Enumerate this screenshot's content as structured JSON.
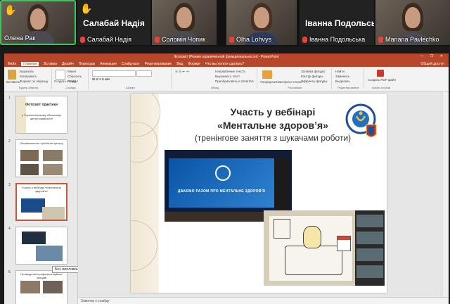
{
  "participants": [
    {
      "name": "Олена Рак",
      "hand_raised": true,
      "muted": false,
      "active_speaker": true,
      "video": true
    },
    {
      "name": "Салабай Надія",
      "big_label": "Салабай Надія",
      "hand_raised": true,
      "muted": true,
      "video": false
    },
    {
      "name": "Соломія Чопик",
      "hand_raised": false,
      "muted": true,
      "video": true
    },
    {
      "name": "Olha Lohvys",
      "hand_raised": false,
      "muted": true,
      "video": true
    },
    {
      "name": "Іванна Подольська",
      "big_label": "Іванна Подольсь",
      "hand_raised": false,
      "muted": true,
      "video": false
    },
    {
      "name": "Mariana Pavlechko",
      "hand_raised": false,
      "muted": true,
      "video": true
    }
  ],
  "powerpoint": {
    "window_title": "Фотозвіт (Режим ограниченной функциональности) - PowerPoint",
    "window_buttons": "— ❐ ✕",
    "menu_tabs": [
      "Файл",
      "Главная",
      "Вставка",
      "Дизайн",
      "Переходы",
      "Анимация",
      "Слайд-шоу",
      "Рецензирование",
      "Вид",
      "Формат",
      "Что вы хотите сделать?"
    ],
    "active_tab": "Главная",
    "share_label": "Общий доступ",
    "ribbon": {
      "paste": "Вставить",
      "cut": "Вырезать",
      "copy": "Копировать",
      "format_painter": "Формат по образцу",
      "clipboard_group": "Буфер обмена",
      "new_slide": "Создать слайд",
      "layout": "Макет",
      "reset": "Сбросить",
      "section": "Раздел",
      "slides_group": "Слайды",
      "font_group": "Шрифт",
      "paragraph_group": "Абзац",
      "text_direction": "Направление текста",
      "align_text": "Выровнять текст",
      "convert_smartart": "Преобразовать в SmartArt",
      "arrange": "Упорядочить",
      "quick_styles": "Экспресс-стили",
      "shape_fill": "Заливка фигуры",
      "shape_outline": "Контур фигуры",
      "shape_effects": "Эффекты фигуры",
      "drawing_group": "Рисование",
      "find": "Найти",
      "replace": "Заменить",
      "select": "Выделить",
      "editing_group": "Редактирование",
      "create_pdf": "Создать PDF-файл",
      "acrobat_group": "Adobe Acrobat"
    },
    "thumbnails": [
      {
        "num": "1",
        "title": "Фотозвіт практики",
        "text": "у Тернопільському обласному центрі зайнятості"
      },
      {
        "num": "2",
        "title": "Ознайомлення з роботою центру",
        "text": ""
      },
      {
        "num": "3",
        "title": "Участь у вебінарі «Ментальне здоров'я»",
        "text": ""
      },
      {
        "num": "4",
        "title": "",
        "text": ""
      },
      {
        "num": "5",
        "title": "Проведення профорієнтаційних заходів",
        "text": ""
      }
    ],
    "thumb_tooltip": "Без заголовка",
    "notes_placeholder": "Заметки к слайду",
    "slide": {
      "title_line1": "Участь у вебінарі",
      "title_line2": "«Ментальне здоров’я»",
      "subtitle": "(тренінгове заняття з шукачами роботи)",
      "photo_screen_text": "ДБАЄМО РАЗОМ ПРО МЕНТАЛЬНЕ ЗДОРОВ'Я",
      "seal_text": "ДЕРЖАВНА СЛУЖБА ЗАЙНЯТОСТІ"
    }
  },
  "colors": {
    "accent_ppt": "#b7472a",
    "active_speaker": "#35c95a",
    "hand": "#f6c94a",
    "muted_mic": "#e0463c"
  }
}
